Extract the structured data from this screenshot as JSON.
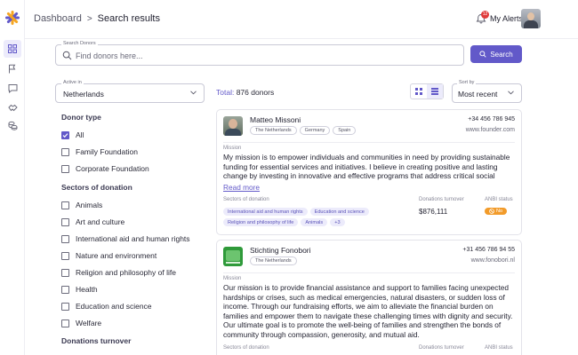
{
  "header": {
    "breadcrumb_root": "Dashboard",
    "breadcrumb_separator": ">",
    "breadcrumb_current": "Search results",
    "alerts_label": "My Alerts",
    "alerts_count": "12"
  },
  "search": {
    "legend": "Search Donors",
    "placeholder": "Find donors here...",
    "button_label": "Search"
  },
  "filters": {
    "active_in_legend": "Active in",
    "active_in_value": "Netherlands",
    "donor_type_heading": "Donor type",
    "donor_types": [
      {
        "label": "All",
        "checked": true
      },
      {
        "label": "Family Foundation",
        "checked": false
      },
      {
        "label": "Corporate Foundation",
        "checked": false
      }
    ],
    "sectors_heading": "Sectors of donation",
    "sectors": [
      {
        "label": "Animals",
        "checked": false
      },
      {
        "label": "Art and culture",
        "checked": false
      },
      {
        "label": "International aid and human rights",
        "checked": false
      },
      {
        "label": "Nature and environment",
        "checked": false
      },
      {
        "label": "Religion and philosophy of life",
        "checked": false
      },
      {
        "label": "Health",
        "checked": false
      },
      {
        "label": "Education and science",
        "checked": false
      },
      {
        "label": "Welfare",
        "checked": false
      }
    ],
    "turnover_heading": "Donations turnover"
  },
  "results": {
    "total_label": "Total:",
    "total_value": "876 donors",
    "sort_legend": "Sort by",
    "sort_value": "Most recent"
  },
  "cards": [
    {
      "name": "Matteo Missoni",
      "tags": [
        "The Netherlands",
        "Germany",
        "Spain"
      ],
      "phone": "+34 456 786 945",
      "website": "www.founder.com",
      "mission_label": "Mission",
      "mission": "My mission is to empower individuals and communities in need by providing sustainable funding for essential services and initiatives. I believe in creating positive and lasting change by investing in innovative and effective programs that address critical social",
      "read_more": "Read more",
      "sectors_label": "Sectors of donation",
      "sectors": [
        "International aid and human rights",
        "Education and science",
        "Religion and philosophy of life",
        "Animals",
        "+3"
      ],
      "turnover_label": "Donations turnover",
      "turnover": "$876,111",
      "anbi_label": "ANBI status",
      "anbi_value": "No"
    },
    {
      "name": "Stichting Fonobori",
      "tags": [
        "The Netherlands"
      ],
      "phone": "+31 456 786 94 55",
      "website": "www.fonobori.nl",
      "mission_label": "Mission",
      "mission": "Our mission is to provide financial assistance and support to families facing unexpected hardships or crises, such as medical emergencies, natural disasters, or sudden loss of income. Through our fundraising efforts, we aim to alleviate the financial burden on families and empower them to navigate these challenging times with dignity and security. Our ultimate goal is to promote the well-being of families and strengthen the bonds of community through compassion, generosity, and mutual aid.",
      "sectors_label": "Sectors of donation",
      "turnover_label": "Donations turnover",
      "anbi_label": "ANBI status"
    }
  ],
  "colors": {
    "accent": "#6259c9",
    "accent_light": "#ecebfb",
    "logo_orange": "#f5a623",
    "logo_purple": "#6259c9",
    "badge_red": "#e03b3b",
    "anbi_orange": "#f29b2a"
  },
  "icons": {
    "sidebar": [
      "grid-icon",
      "flag-icon",
      "chat-icon",
      "handshake-icon",
      "coins-icon"
    ]
  }
}
